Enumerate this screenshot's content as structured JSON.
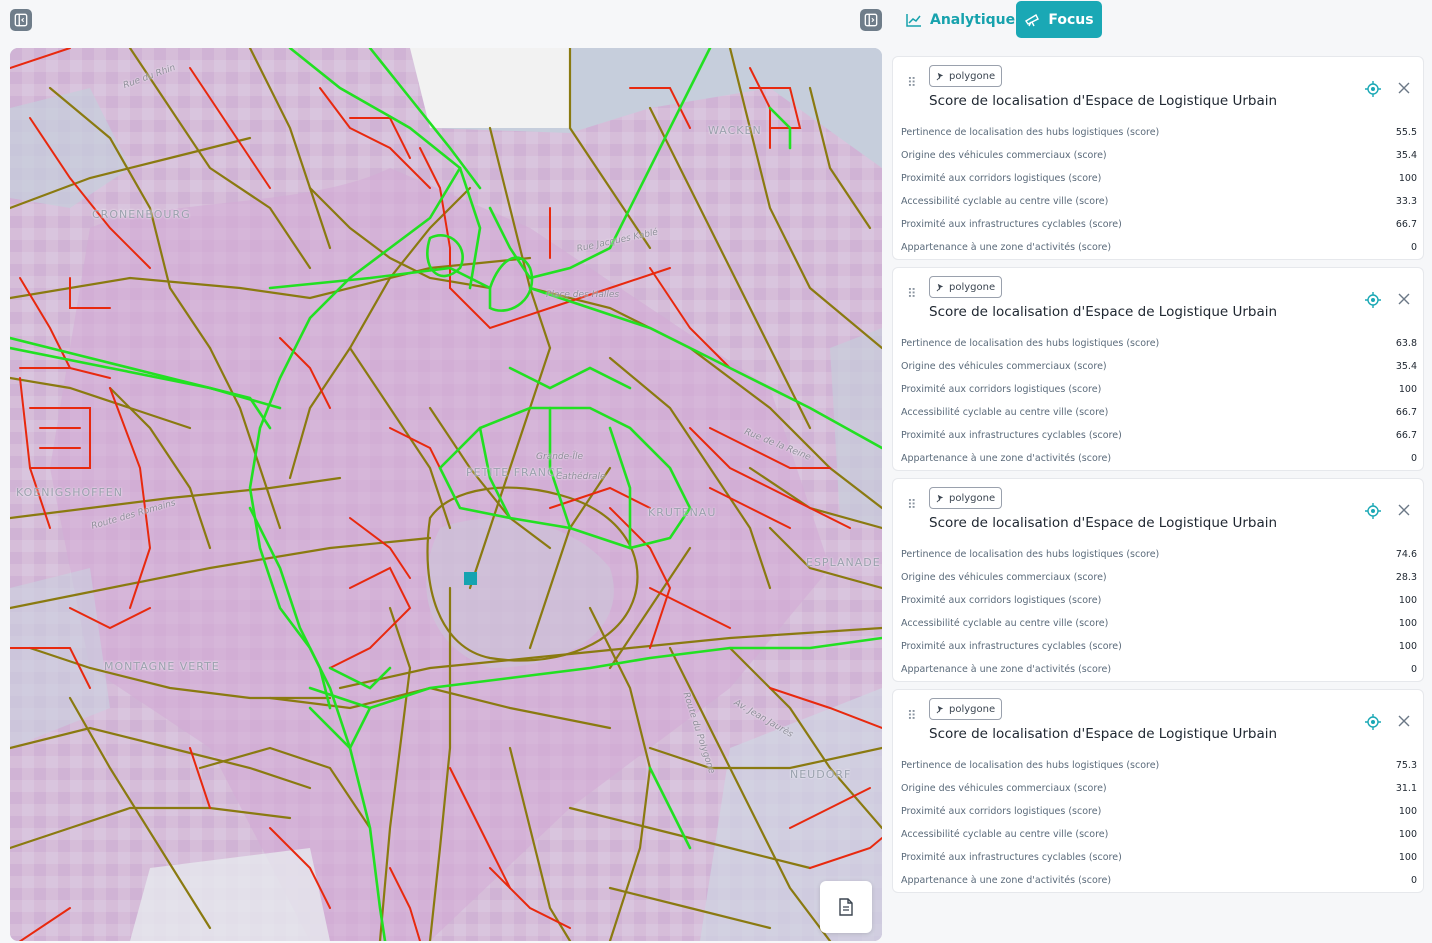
{
  "toolbar": {
    "analytique_label": "Analytique",
    "focus_label": "Focus"
  },
  "map": {
    "labels": {
      "cronenbourg": "CRONENBOURG",
      "wacken": "WACKEN",
      "koenigshoffen": "KOENIGSHOFFEN",
      "petite_france": "PETITE FRANCE",
      "krutenau": "KRUTENAU",
      "esplanade": "ESPLANADE",
      "montagne_verte": "MONTAGNE VERTE",
      "neudorf": "NEUDORF",
      "grande_ile": "Grande-Île",
      "cathedrale": "Cathédrale",
      "rue_jacques_kable": "Rue Jacques Kablé",
      "route_des_romains": "Route des Romains",
      "rue_du_rhin": "Rue du Rhin",
      "place_des_halles": "Place des Halles",
      "av_jean_jaures": "Av. Jean Jaurès",
      "rue_de_la_reine": "Rue de la Reine",
      "route_du_polygone": "Route du Polygone"
    }
  },
  "cards": [
    {
      "badge": "polygone",
      "title": "Score de localisation d'Espace de Logistique Urbain",
      "rows": [
        {
          "label": "Pertinence de localisation des hubs logistiques (score)",
          "value": "55.5"
        },
        {
          "label": "Origine des véhicules commerciaux (score)",
          "value": "35.4"
        },
        {
          "label": "Proximité aux corridors logistiques (score)",
          "value": "100"
        },
        {
          "label": "Accessibilité cyclable au centre ville (score)",
          "value": "33.3"
        },
        {
          "label": "Proximité aux infrastructures cyclables (score)",
          "value": "66.7"
        },
        {
          "label": "Appartenance à une zone d'activités (score)",
          "value": "0"
        }
      ]
    },
    {
      "badge": "polygone",
      "title": "Score de localisation d'Espace de Logistique Urbain",
      "rows": [
        {
          "label": "Pertinence de localisation des hubs logistiques (score)",
          "value": "63.8"
        },
        {
          "label": "Origine des véhicules commerciaux (score)",
          "value": "35.4"
        },
        {
          "label": "Proximité aux corridors logistiques (score)",
          "value": "100"
        },
        {
          "label": "Accessibilité cyclable au centre ville (score)",
          "value": "66.7"
        },
        {
          "label": "Proximité aux infrastructures cyclables (score)",
          "value": "66.7"
        },
        {
          "label": "Appartenance à une zone d'activités (score)",
          "value": "0"
        }
      ]
    },
    {
      "badge": "polygone",
      "title": "Score de localisation d'Espace de Logistique Urbain",
      "rows": [
        {
          "label": "Pertinence de localisation des hubs logistiques (score)",
          "value": "74.6"
        },
        {
          "label": "Origine des véhicules commerciaux (score)",
          "value": "28.3"
        },
        {
          "label": "Proximité aux corridors logistiques (score)",
          "value": "100"
        },
        {
          "label": "Accessibilité cyclable au centre ville (score)",
          "value": "100"
        },
        {
          "label": "Proximité aux infrastructures cyclables (score)",
          "value": "100"
        },
        {
          "label": "Appartenance à une zone d'activités (score)",
          "value": "0"
        }
      ]
    },
    {
      "badge": "polygone",
      "title": "Score de localisation d'Espace de Logistique Urbain",
      "rows": [
        {
          "label": "Pertinence de localisation des hubs logistiques (score)",
          "value": "75.3"
        },
        {
          "label": "Origine des véhicules commerciaux (score)",
          "value": "31.1"
        },
        {
          "label": "Proximité aux corridors logistiques (score)",
          "value": "100"
        },
        {
          "label": "Accessibilité cyclable au centre ville (score)",
          "value": "100"
        },
        {
          "label": "Proximité aux infrastructures cyclables (score)",
          "value": "100"
        },
        {
          "label": "Appartenance à une zone d'activités (score)",
          "value": "0"
        }
      ]
    }
  ],
  "colors": {
    "accent": "#1aa8b5",
    "road_red": "#e8290e",
    "road_olive": "#8a7a10",
    "road_green": "#22e022",
    "heat_pink": "#d8b4d8"
  }
}
